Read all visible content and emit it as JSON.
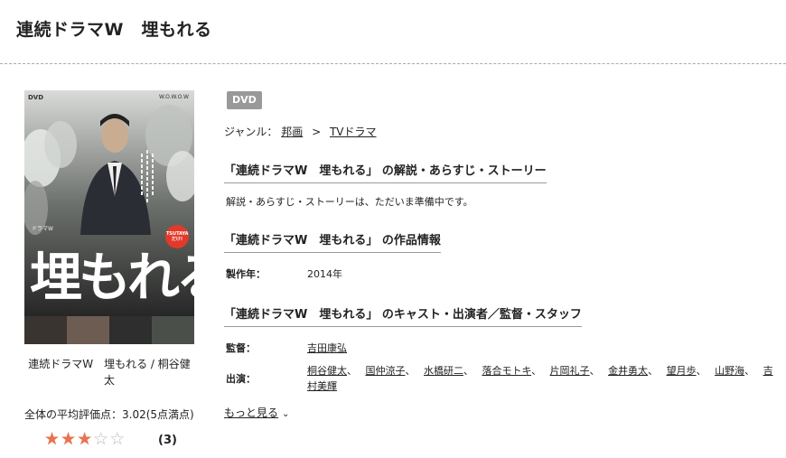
{
  "page": {
    "title": "連続ドラマW　埋もれる"
  },
  "poster": {
    "label_dvd": "DVD",
    "label_wowow": "W.O.W.O.W",
    "label_drama": "ドラマW",
    "big_title": "埋もれる",
    "tag": "TSUTAYAだけ!"
  },
  "caption": "連続ドラマW　埋もれる / 桐谷健太",
  "rating": {
    "average_text": "全体の平均評価点：3.02(5点満点)",
    "value": 3.02,
    "max": 5,
    "stars": [
      "★",
      "★",
      "★",
      "☆",
      "☆"
    ],
    "review_count": "(3)",
    "star_on_color": "#e9734f",
    "star_off_color": "#bbbbbb"
  },
  "badge": "DVD",
  "genre": {
    "label": "ジャンル：",
    "items": [
      "邦画",
      "TVドラマ"
    ],
    "separator": ">"
  },
  "sections": {
    "story_title": "「連続ドラマW　埋もれる」 の解説・あらすじ・ストーリー",
    "story_text": "解説・あらすじ・ストーリーは、ただいま準備中です。",
    "info_title": "「連続ドラマW　埋もれる」 の作品情報",
    "year_label": "製作年：",
    "year_value": "2014年",
    "cast_title": "「連続ドラマW　埋もれる」 のキャスト・出演者／監督・スタッフ",
    "director_label": "監督：",
    "director": "吉田康弘",
    "cast_label": "出演：",
    "cast": [
      "桐谷健太",
      "国仲涼子",
      "水橋研二",
      "落合モトキ",
      "片岡礼子",
      "金井勇太",
      "望月歩",
      "山野海",
      "吉村美輝"
    ],
    "more": "もっと見る"
  }
}
